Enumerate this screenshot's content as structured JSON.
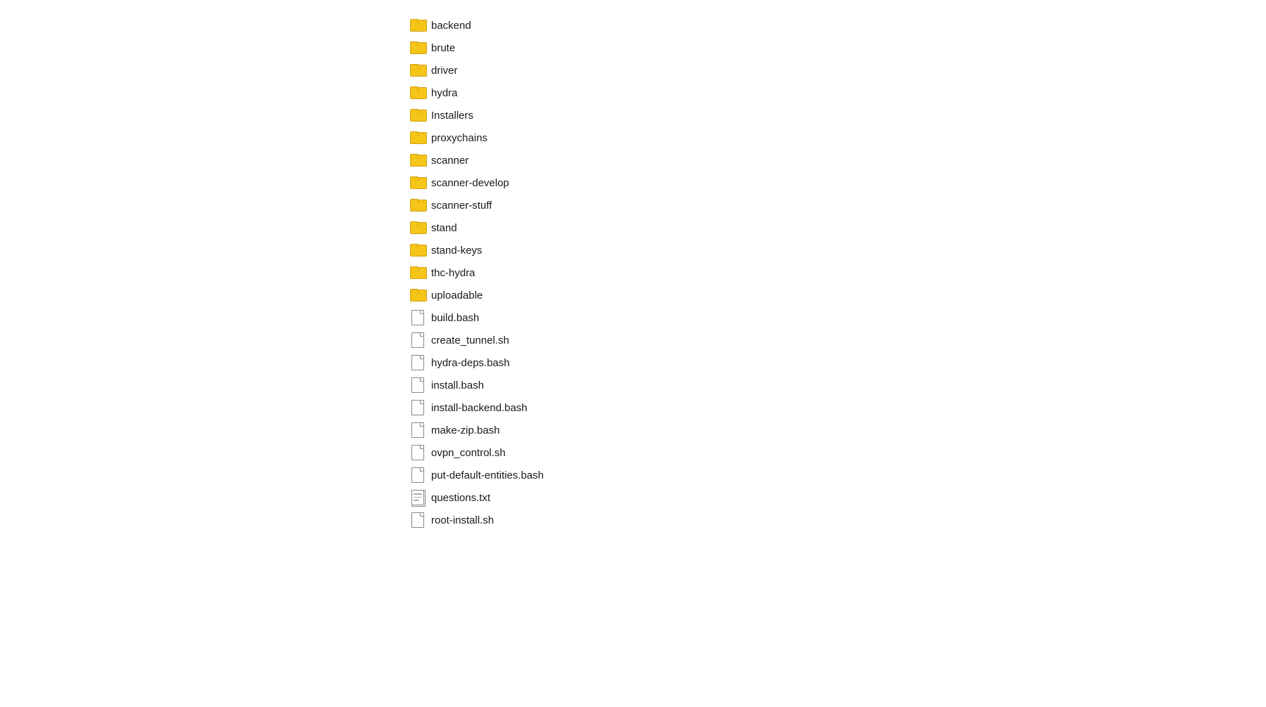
{
  "fileList": {
    "items": [
      {
        "id": "backend",
        "name": "backend",
        "type": "folder"
      },
      {
        "id": "brute",
        "name": "brute",
        "type": "folder"
      },
      {
        "id": "driver",
        "name": "driver",
        "type": "folder"
      },
      {
        "id": "hydra",
        "name": "hydra",
        "type": "folder"
      },
      {
        "id": "Installers",
        "name": "Installers",
        "type": "folder"
      },
      {
        "id": "proxychains",
        "name": "proxychains",
        "type": "folder"
      },
      {
        "id": "scanner",
        "name": "scanner",
        "type": "folder"
      },
      {
        "id": "scanner-develop",
        "name": "scanner-develop",
        "type": "folder"
      },
      {
        "id": "scanner-stuff",
        "name": "scanner-stuff",
        "type": "folder"
      },
      {
        "id": "stand",
        "name": "stand",
        "type": "folder"
      },
      {
        "id": "stand-keys",
        "name": "stand-keys",
        "type": "folder"
      },
      {
        "id": "thc-hydra",
        "name": "thc-hydra",
        "type": "folder"
      },
      {
        "id": "uploadable",
        "name": "uploadable",
        "type": "folder"
      },
      {
        "id": "build.bash",
        "name": "build.bash",
        "type": "file"
      },
      {
        "id": "create_tunnel.sh",
        "name": "create_tunnel.sh",
        "type": "file"
      },
      {
        "id": "hydra-deps.bash",
        "name": "hydra-deps.bash",
        "type": "file"
      },
      {
        "id": "install.bash",
        "name": "install.bash",
        "type": "file"
      },
      {
        "id": "install-backend.bash",
        "name": "install-backend.bash",
        "type": "file"
      },
      {
        "id": "make-zip.bash",
        "name": "make-zip.bash",
        "type": "file"
      },
      {
        "id": "ovpn_control.sh",
        "name": "ovpn_control.sh",
        "type": "file"
      },
      {
        "id": "put-default-entities.bash",
        "name": "put-default-entities.bash",
        "type": "file"
      },
      {
        "id": "questions.txt",
        "name": "questions.txt",
        "type": "txt"
      },
      {
        "id": "root-install.sh",
        "name": "root-install.sh",
        "type": "file"
      }
    ]
  }
}
